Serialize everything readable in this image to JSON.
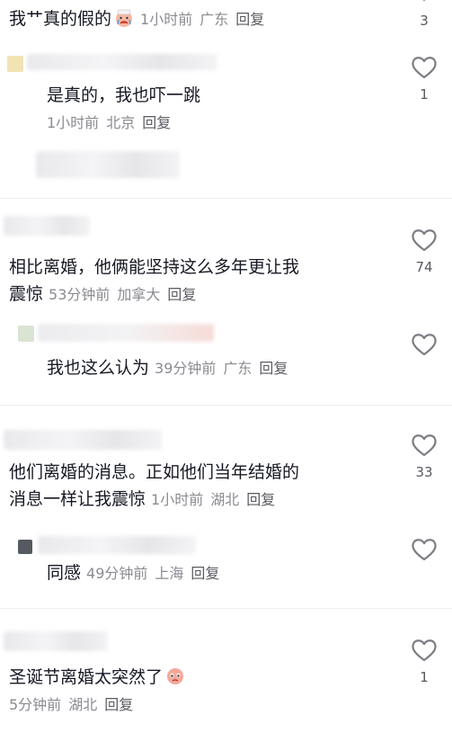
{
  "comments": [
    {
      "text_prefix": "我艹真的假的",
      "time": "1小时前",
      "location": "广东",
      "reply_label": "回复",
      "likes": "3",
      "emoji": "crying-face-emoji"
    },
    {
      "text": "是真的，我也吓一跳",
      "time": "1小时前",
      "location": "北京",
      "reply_label": "回复",
      "likes": "1"
    },
    {
      "text_line1": "相比离婚，他俩能坚持这么多年更让我",
      "text_line2": "震惊",
      "time": "53分钟前",
      "location": "加拿大",
      "reply_label": "回复",
      "likes": "74"
    },
    {
      "text": "我也这么认为",
      "time": "39分钟前",
      "location": "广东",
      "reply_label": "回复",
      "likes": ""
    },
    {
      "text_line1": "他们离婚的消息。正如他们当年结婚的",
      "text_line2": "消息一样让我震惊",
      "time": "1小时前",
      "location": "湖北",
      "reply_label": "回复",
      "likes": "33"
    },
    {
      "text": "同感",
      "time": "49分钟前",
      "location": "上海",
      "reply_label": "回复",
      "likes": ""
    },
    {
      "text": "圣诞节离婚太突然了",
      "time": "5分钟前",
      "location": "湖北",
      "reply_label": "回复",
      "likes": "1",
      "emoji": "pleading-face-emoji"
    }
  ],
  "colors": {
    "text": "#161823",
    "meta": "#8a8b91",
    "divider": "#efeff1"
  }
}
